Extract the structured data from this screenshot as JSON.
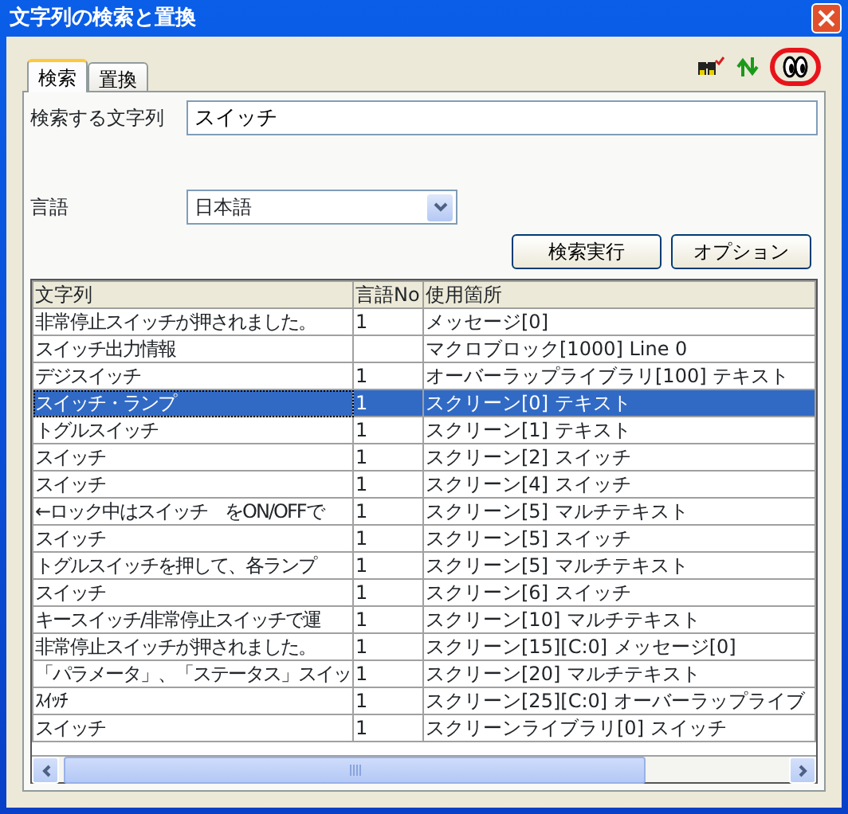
{
  "window": {
    "title": "文字列の検索と置換"
  },
  "tabs": [
    {
      "label": "検索",
      "selected": true
    },
    {
      "label": "置換",
      "selected": false
    }
  ],
  "search_field": {
    "label": "検索する文字列",
    "value": "スイッチ"
  },
  "language": {
    "label": "言語",
    "value": "日本語"
  },
  "buttons": [
    "検索実行",
    "オプション"
  ],
  "table": {
    "columns": [
      "文字列",
      "言語No",
      "使用箇所"
    ],
    "rows": [
      {
        "string": "非常停止スイッチが押されました。",
        "language_no": "1",
        "location": "メッセージ[0]",
        "selected": false
      },
      {
        "string": "スイッチ出力情報",
        "location": "マクロブロック[1000] Line 0",
        "selected": false
      },
      {
        "string": "デジスイッチ",
        "language_no": "1",
        "location": "オーバーラップライブラリ[100] テキスト",
        "selected": false
      },
      {
        "string": "スイッチ・ランプ",
        "language_no": "1",
        "location": "スクリーン[0] テキスト",
        "selected": true
      },
      {
        "string": "トグルスイッチ",
        "language_no": "1",
        "location": "スクリーン[1] テキスト",
        "selected": false
      },
      {
        "string": "スイッチ",
        "language_no": "1",
        "location": "スクリーン[2] スイッチ",
        "selected": false
      },
      {
        "string": "スイッチ",
        "language_no": "1",
        "location": "スクリーン[4] スイッチ",
        "selected": false
      },
      {
        "string": "←ロック中はスイッチ　をON/OFFで",
        "language_no": "1",
        "location": "スクリーン[5] マルチテキスト",
        "selected": false
      },
      {
        "string": "スイッチ",
        "language_no": "1",
        "location": "スクリーン[5] スイッチ",
        "selected": false
      },
      {
        "string": "トグルスイッチを押して、各ランプ",
        "language_no": "1",
        "location": "スクリーン[5] マルチテキスト",
        "selected": false
      },
      {
        "string": "スイッチ",
        "language_no": "1",
        "location": "スクリーン[6] スイッチ",
        "selected": false
      },
      {
        "string": "キースイッチ/非常停止スイッチで運",
        "language_no": "1",
        "location": "スクリーン[10] マルチテキスト",
        "selected": false
      },
      {
        "string": "非常停止スイッチが押されました。",
        "language_no": "1",
        "location": "スクリーン[15][C:0] メッセージ[0]",
        "selected": false
      },
      {
        "string": "「パラメータ」、「ステータス」スイッ",
        "language_no": "1",
        "location": "スクリーン[20] マルチテキスト",
        "selected": false
      },
      {
        "string": "ｽｲｯﾁ",
        "language_no": "1",
        "location": "スクリーン[25][C:0] オーバーラップライブ",
        "selected": false
      },
      {
        "string": "スイッチ",
        "language_no": "1",
        "location": "スクリーンライブラリ[0] スイッチ",
        "selected": false
      }
    ]
  }
}
